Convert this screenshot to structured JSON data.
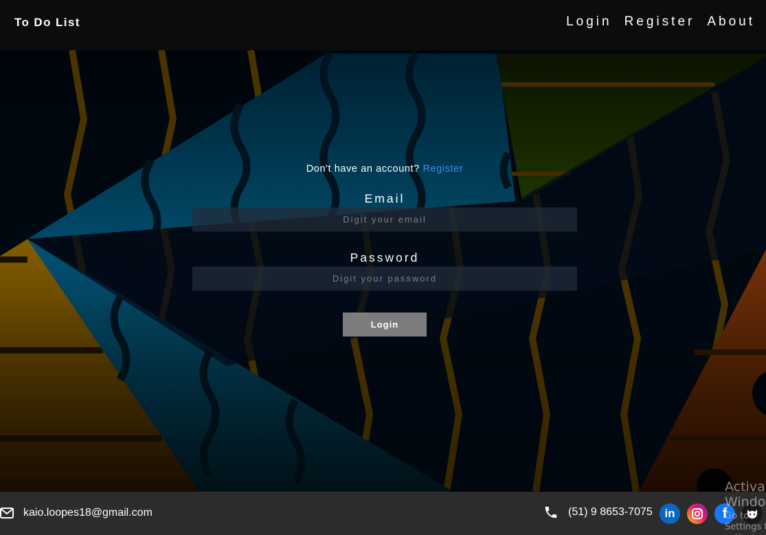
{
  "header": {
    "brand": "To Do List",
    "nav": [
      "Login",
      "Register",
      "About"
    ]
  },
  "form": {
    "signup_prompt": "Don't have an account?",
    "signup_link": "Register",
    "email_label": "Email",
    "email_placeholder": "Digit your email",
    "password_label": "Password",
    "password_placeholder": "Digit your password",
    "submit_label": "Login"
  },
  "footer": {
    "email": "kaio.loopes18@gmail.com",
    "phone": "(51) 9 8653-7075",
    "socials": [
      "linkedin-icon",
      "instagram-icon",
      "facebook-icon",
      "github-icon"
    ]
  },
  "watermark": {
    "line1": "Activate Windows",
    "line2": "Go to Settings to activate Windows."
  },
  "colors": {
    "header_bg": "#0c0c0c",
    "footer_bg": "#2c2c2c",
    "link_accent": "#3d8ee6",
    "button_bg": "#7c7c7c"
  }
}
